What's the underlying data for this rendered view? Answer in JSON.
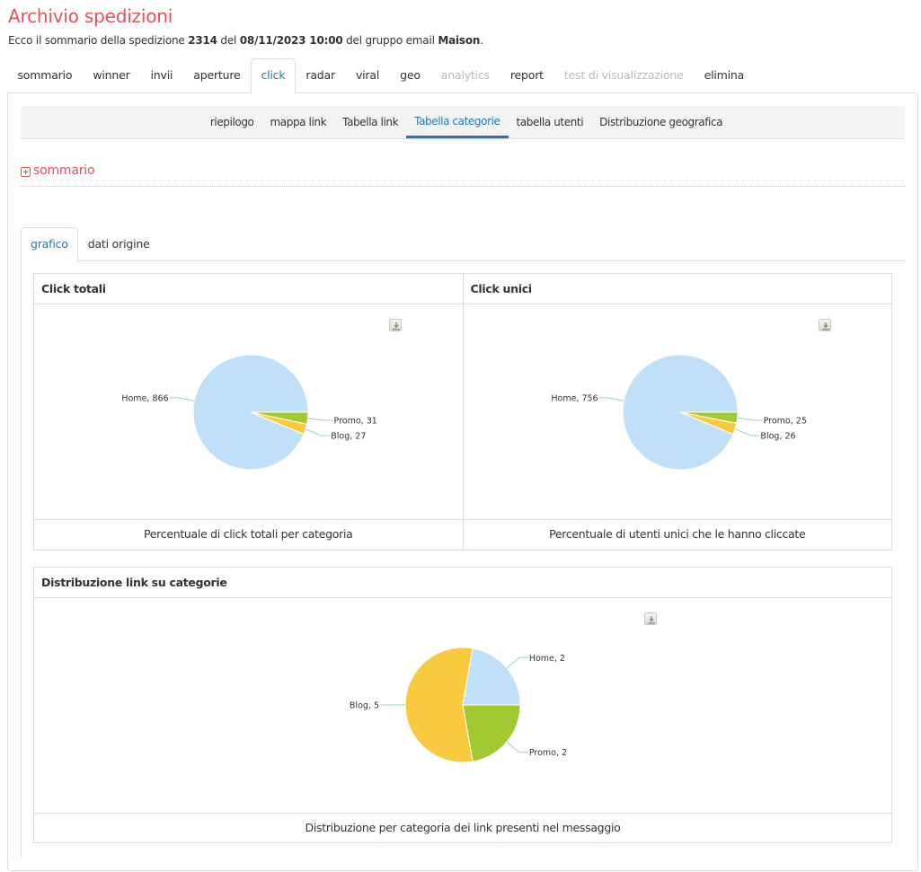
{
  "header": {
    "title": "Archivio spedizioni",
    "subtitle_parts": {
      "prefix": "Ecco il sommario della spedizione ",
      "id": "2314",
      "mid1": " del ",
      "datetime": "08/11/2023 10:00",
      "mid2": " del gruppo email ",
      "group": "Maison",
      "suffix": "."
    }
  },
  "main_tabs": [
    {
      "label": "sommario",
      "state": "normal"
    },
    {
      "label": "winner",
      "state": "normal"
    },
    {
      "label": "invii",
      "state": "normal"
    },
    {
      "label": "aperture",
      "state": "normal"
    },
    {
      "label": "click",
      "state": "active"
    },
    {
      "label": "radar",
      "state": "normal"
    },
    {
      "label": "viral",
      "state": "normal"
    },
    {
      "label": "geo",
      "state": "normal"
    },
    {
      "label": "analytics",
      "state": "disabled"
    },
    {
      "label": "report",
      "state": "normal"
    },
    {
      "label": "test di visualizzazione",
      "state": "disabled"
    },
    {
      "label": "elimina",
      "state": "normal"
    }
  ],
  "sub_tabs": [
    {
      "label": "riepilogo",
      "active": false
    },
    {
      "label": "mappa link",
      "active": false
    },
    {
      "label": "Tabella link",
      "active": false
    },
    {
      "label": "Tabella categorie",
      "active": true
    },
    {
      "label": "tabella utenti",
      "active": false
    },
    {
      "label": "Distribuzione geografica",
      "active": false
    }
  ],
  "sommario_toggle": {
    "label": "sommario",
    "icon": "plus-square-icon"
  },
  "inner_tabs": [
    {
      "label": "grafico",
      "active": true
    },
    {
      "label": "dati origine",
      "active": false
    }
  ],
  "colors": {
    "accent_red": "#e8505b",
    "accent_blue": "#1f78b4",
    "home": "#c0e0f8",
    "blog": "#f7ca3f",
    "promo": "#a3c932",
    "leader": "#9ecbd6"
  },
  "chart_data": [
    {
      "type": "pie",
      "title": "Click totali",
      "caption": "Percentuale di click totali per categoria",
      "categories": [
        "Home",
        "Promo",
        "Blog"
      ],
      "values": [
        866,
        31,
        27
      ],
      "labels": [
        "Home, 866",
        "Promo, 31",
        "Blog, 27"
      ],
      "download_icon": "download-icon"
    },
    {
      "type": "pie",
      "title": "Click unici",
      "caption": "Percentuale di utenti unici che le hanno cliccate",
      "categories": [
        "Home",
        "Promo",
        "Blog"
      ],
      "values": [
        756,
        25,
        26
      ],
      "labels": [
        "Home, 756",
        "Promo, 25",
        "Blog, 26"
      ],
      "download_icon": "download-icon"
    },
    {
      "type": "pie",
      "title": "Distribuzione link su categorie",
      "caption": "Distribuzione per categoria dei link presenti nel messaggio",
      "categories": [
        "Home",
        "Promo",
        "Blog"
      ],
      "values": [
        2,
        2,
        5
      ],
      "labels": [
        "Home, 2",
        "Promo, 2",
        "Blog, 5"
      ],
      "download_icon": "download-icon"
    }
  ]
}
